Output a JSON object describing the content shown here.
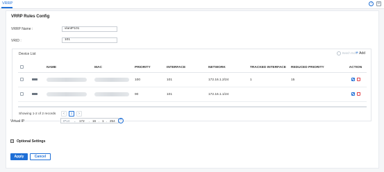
{
  "header": {
    "tab_label": "VRRP",
    "help_icon": "help-icon",
    "settings_icon": "settings-icon"
  },
  "form": {
    "title": "VRRP Rules Config",
    "vrrp_name_label": "VRRP Name :",
    "vrrp_name_value": "vlanIP101",
    "vrid_label": "VRID :",
    "vrid_value": "101"
  },
  "device_list": {
    "title": "Device List",
    "batch_edit": "Batch Edit",
    "add": "Add",
    "columns": [
      "NAME",
      "MAC",
      "PRIORITY",
      "INTERFACE",
      "NETWORK",
      "TRACKED INTERFACE",
      "REDUCED PRIORITY",
      "ACTION"
    ],
    "rows": [
      {
        "priority": "100",
        "interface": "101",
        "network": "172.16.1.2/24",
        "tracked_interface": "1",
        "reduced_priority": "15"
      },
      {
        "priority": "90",
        "interface": "101",
        "network": "172.16.1.1/24",
        "tracked_interface": "",
        "reduced_priority": ""
      }
    ],
    "pagination": {
      "summary": "Showing 1-2 of 2 records",
      "prev": "<",
      "current_page": "1",
      "next": ">"
    }
  },
  "virtual_ip": {
    "label": "Virtual IP",
    "ip_version": "IPv4",
    "octets": [
      "172",
      "16",
      "1",
      "254"
    ],
    "dot": "."
  },
  "optional": {
    "toggle": "+",
    "label": "Optional Settings"
  },
  "actions": {
    "apply": "Apply",
    "cancel": "Cancel"
  },
  "colors": {
    "accent": "#1f6fd6",
    "danger": "#e0454b"
  }
}
